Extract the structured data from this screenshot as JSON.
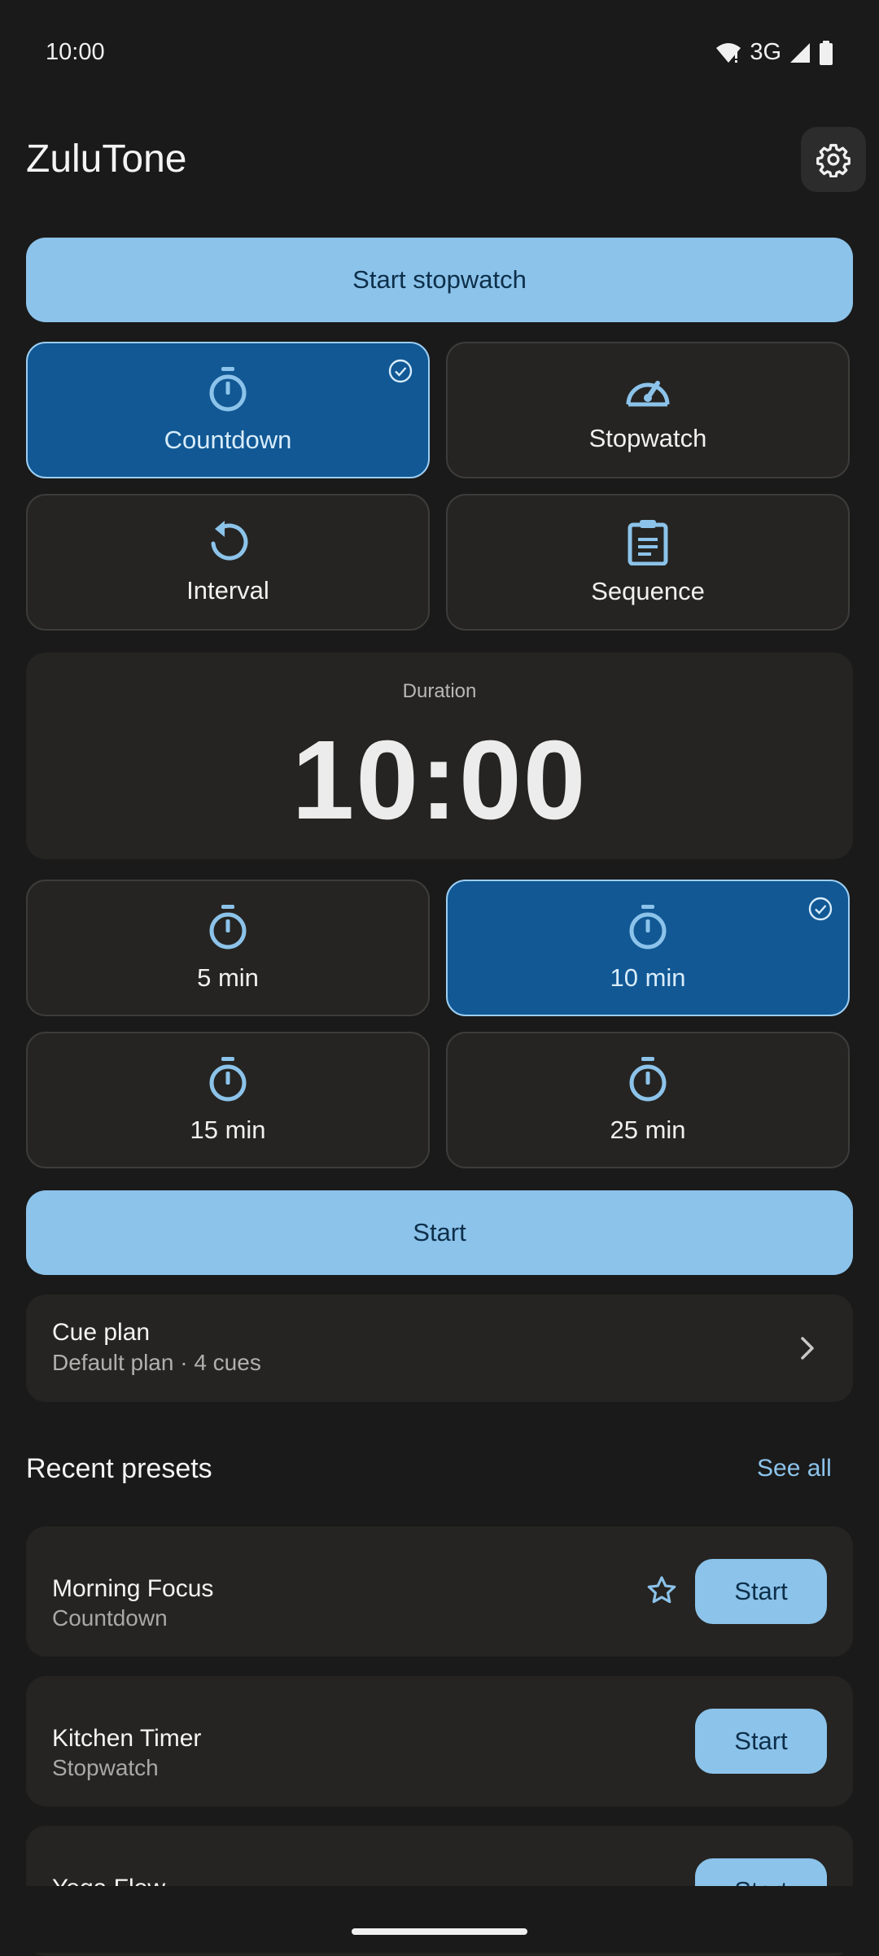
{
  "status_bar": {
    "time": "10:00",
    "network": "3G",
    "icons": [
      "wifi-icon",
      "signal-icon",
      "battery-icon"
    ]
  },
  "app": {
    "title": "ZuluTone",
    "settings_icon": "gear-icon"
  },
  "start_stopwatch_label": "Start stopwatch",
  "modes": [
    {
      "label": "Countdown",
      "icon": "timer-icon",
      "selected": true
    },
    {
      "label": "Stopwatch",
      "icon": "speedometer-icon",
      "selected": false
    },
    {
      "label": "Interval",
      "icon": "restart-icon",
      "selected": false
    },
    {
      "label": "Sequence",
      "icon": "clipboard-icon",
      "selected": false
    }
  ],
  "duration": {
    "label": "Duration",
    "value": "10:00"
  },
  "presets_quick": [
    {
      "label": "5 min",
      "icon": "timer-icon",
      "selected": false
    },
    {
      "label": "10 min",
      "icon": "timer-icon",
      "selected": true
    },
    {
      "label": "15 min",
      "icon": "timer-icon",
      "selected": false
    },
    {
      "label": "25 min",
      "icon": "timer-icon",
      "selected": false
    }
  ],
  "start_label": "Start",
  "cue_plan": {
    "title": "Cue plan",
    "subtitle": "Default plan · 4 cues"
  },
  "recent": {
    "title": "Recent presets",
    "see_all": "See all",
    "items": [
      {
        "name": "Morning Focus",
        "type": "Countdown",
        "start": "Start",
        "favorite": true
      },
      {
        "name": "Kitchen Timer",
        "type": "Stopwatch",
        "start": "Start",
        "favorite": false
      },
      {
        "name": "Yoga Flow",
        "type": "",
        "start": "Start",
        "favorite": false
      }
    ]
  },
  "colors": {
    "background": "#1a1a1a",
    "accent": "#8cc3ea",
    "selected": "#115894",
    "card": "#252422"
  }
}
